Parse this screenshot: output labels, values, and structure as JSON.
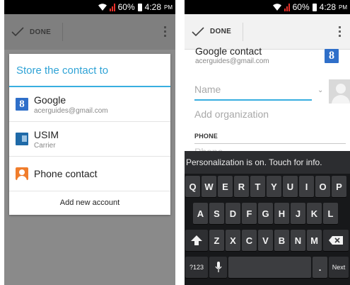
{
  "status_bar": {
    "battery": "60%",
    "time": "4:28",
    "ampm": "PM"
  },
  "action_bar": {
    "done_label": "DONE"
  },
  "dialog": {
    "title": "Store the contact to",
    "options": [
      {
        "icon": "google-account-icon",
        "label": "Google",
        "sublabel": "acerguides@gmail.com"
      },
      {
        "icon": "sim-card-icon",
        "label": "USIM",
        "sublabel": "Carrier"
      },
      {
        "icon": "phone-contact-icon",
        "label": "Phone contact"
      }
    ],
    "add_account": "Add new account"
  },
  "form": {
    "account_name": "Google contact",
    "account_email": "acerguides@gmail.com",
    "name_placeholder": "Name",
    "organization_placeholder": "Add organization",
    "phone_header": "PHONE",
    "phone_placeholder": "Phone"
  },
  "keyboard": {
    "notice": "Personalization is on. Touch for info.",
    "row1": [
      "Q",
      "W",
      "E",
      "R",
      "T",
      "Y",
      "U",
      "I",
      "O",
      "P"
    ],
    "row2": [
      "A",
      "S",
      "D",
      "F",
      "G",
      "H",
      "J",
      "K",
      "L"
    ],
    "row3": [
      "Z",
      "X",
      "C",
      "V",
      "B",
      "N",
      "M"
    ],
    "symbols_key": "?123",
    "period_key": ".",
    "next_key": "Next",
    "shift_icon": "shift-icon",
    "delete_icon": "backspace-icon",
    "mic_icon": "microphone-icon"
  },
  "colors": {
    "accent": "#38aee0",
    "signal": "#e8302a"
  }
}
